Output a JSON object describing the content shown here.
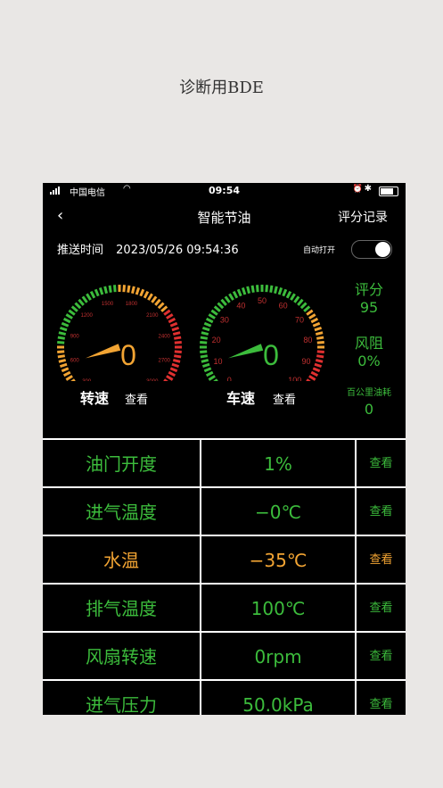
{
  "caption": "诊断用BDE",
  "status_bar": {
    "carrier": "中国电信",
    "time": "09:54"
  },
  "nav": {
    "title": "智能节油",
    "record": "评分记录"
  },
  "push": {
    "label": "推送时间",
    "value": "2023/05/26 09:54:36",
    "auto_label": "自动打开"
  },
  "rpm_gauge": {
    "value": "0",
    "ticks": [
      "300",
      "600",
      "900",
      "1200",
      "1500",
      "1800",
      "2100",
      "2400",
      "2700",
      "3000"
    ],
    "label": "转速",
    "link": "查看"
  },
  "speed_gauge": {
    "value": "0",
    "ticks": [
      "0",
      "10",
      "20",
      "30",
      "40",
      "50",
      "60",
      "70",
      "80",
      "90",
      "100"
    ],
    "label": "车速",
    "link": "查看"
  },
  "side": {
    "score_label": "评分",
    "score_value": "95",
    "wind_label": "风阻",
    "wind_value": "0%",
    "fuel_label": "百公里油耗",
    "fuel_value": "0"
  },
  "rows": [
    {
      "name": "油门开度",
      "value": "1%",
      "link": "查看",
      "color": "#3cbc3c"
    },
    {
      "name": "进气温度",
      "value": "−0℃",
      "link": "查看",
      "color": "#3cbc3c"
    },
    {
      "name": "水温",
      "value": "−35℃",
      "link": "查看",
      "color": "#f2a433"
    },
    {
      "name": "排气温度",
      "value": "100℃",
      "link": "查看",
      "color": "#3cbc3c"
    },
    {
      "name": "风扇转速",
      "value": "0rpm",
      "link": "查看",
      "color": "#3cbc3c"
    },
    {
      "name": "进气压力",
      "value": "50.0kPa",
      "link": "查看",
      "color": "#3cbc3c"
    }
  ],
  "colors": {
    "green": "#3cbc3c",
    "orange": "#f2a433",
    "red": "#e03030",
    "gauge_orange": "#f2a433"
  }
}
